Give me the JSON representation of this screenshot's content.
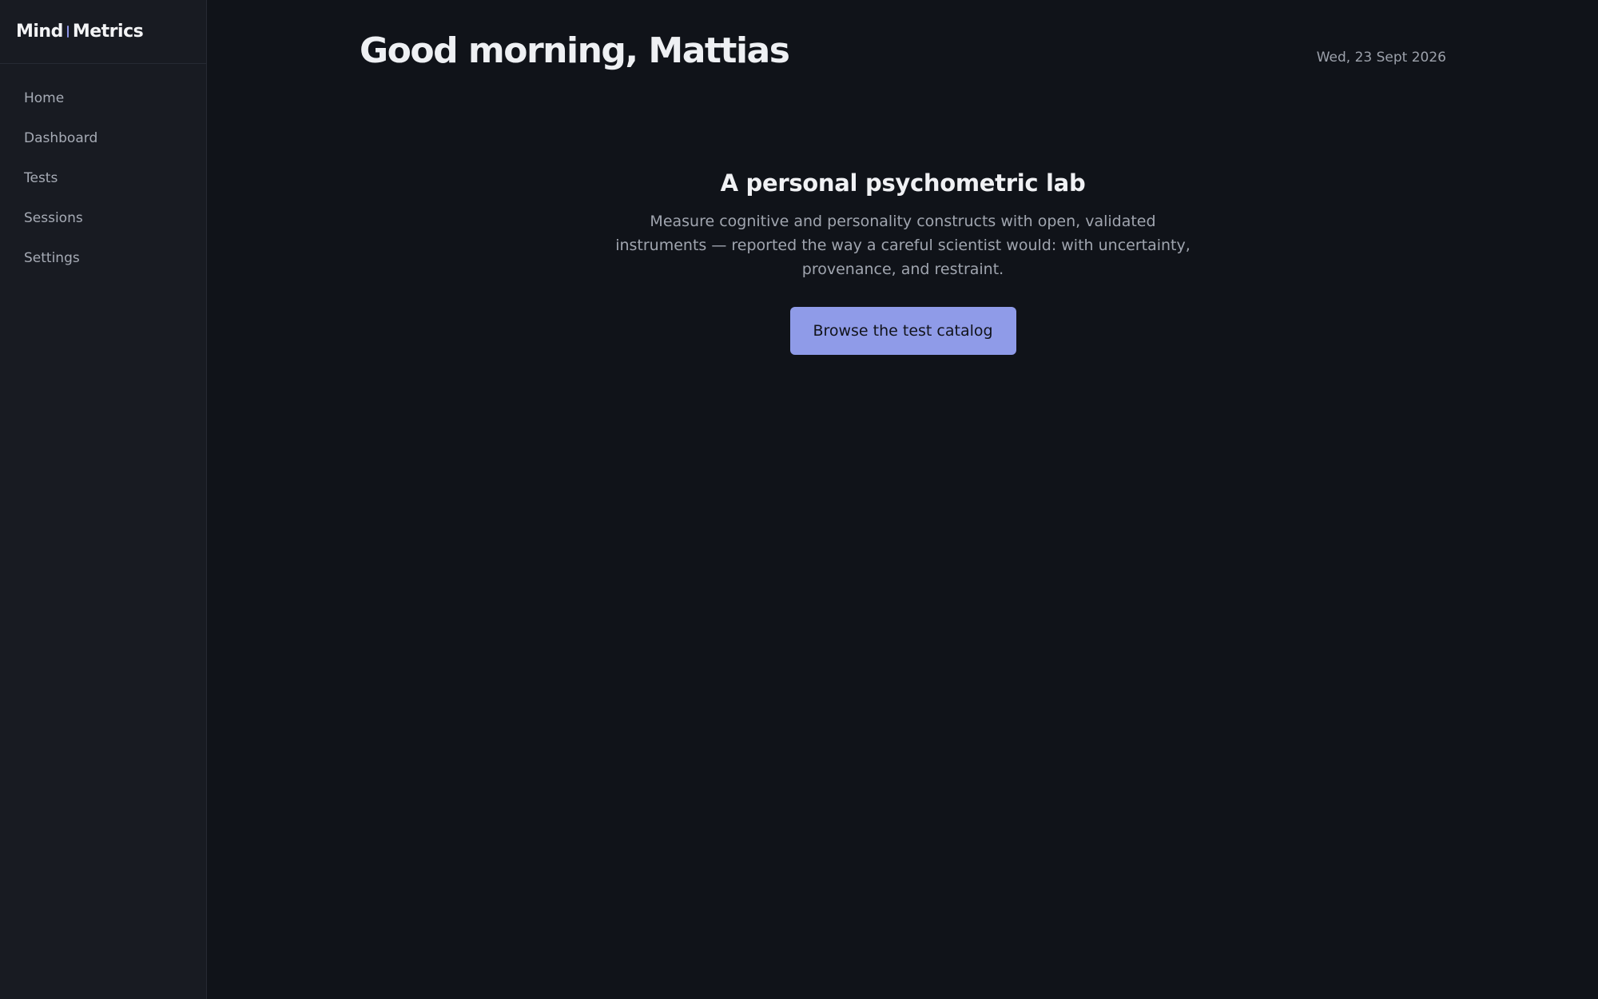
{
  "brand": {
    "part1": "Mind",
    "part2": "Metrics"
  },
  "sidebar": {
    "items": [
      {
        "label": "Home"
      },
      {
        "label": "Dashboard"
      },
      {
        "label": "Tests"
      },
      {
        "label": "Sessions"
      },
      {
        "label": "Settings"
      }
    ]
  },
  "header": {
    "greeting": "Good morning, Mattias",
    "date": "Wed, 23 Sept 2026"
  },
  "hero": {
    "title": "A personal psychometric lab",
    "description": "Measure cognitive and personality constructs with open, validated instruments — reported the way a careful scientist would: with uncertainty, provenance, and restraint.",
    "cta_label": "Browse the test catalog"
  },
  "colors": {
    "background": "#101319",
    "sidebar": "#181b22",
    "accent": "#8f9be8"
  }
}
